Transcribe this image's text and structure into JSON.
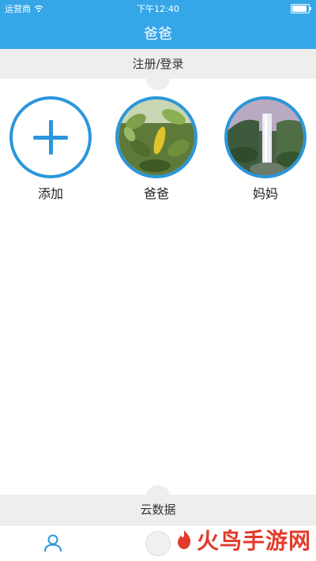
{
  "status_bar": {
    "carrier": "运营商",
    "time": "下午12:40",
    "battery_level": 1.0
  },
  "header": {
    "title": "爸爸"
  },
  "top_bar": {
    "label": "注册/登录"
  },
  "profiles": [
    {
      "label": "添加",
      "kind": "add"
    },
    {
      "label": "爸爸",
      "kind": "photo",
      "image": "leaves"
    },
    {
      "label": "妈妈",
      "kind": "photo",
      "image": "waterfall"
    }
  ],
  "bottom_bar": {
    "label": "云数据"
  },
  "tabbar": {
    "left_icon": "user-icon",
    "center_icon": "toggle-icon"
  },
  "watermark": {
    "text": "火鸟手游网"
  },
  "colors": {
    "primary": "#35a6e8",
    "accent": "#2b96db",
    "bar_bg": "#eeeeee",
    "watermark": "#e23b2c"
  }
}
